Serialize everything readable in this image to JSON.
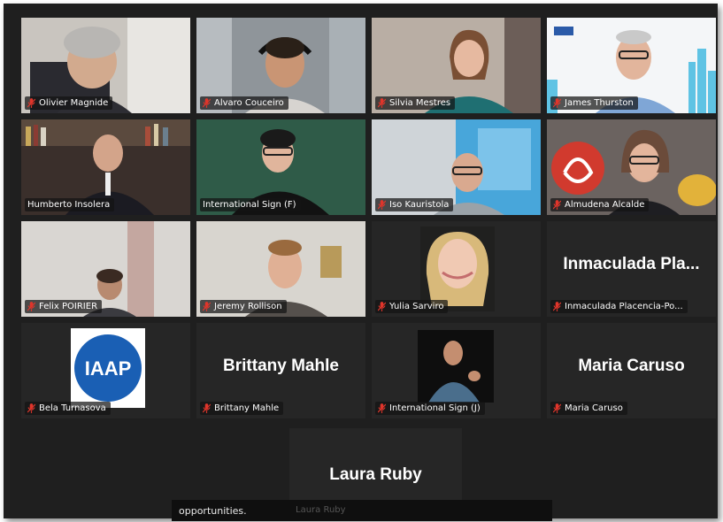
{
  "meeting": {
    "tiles": [
      {
        "name": "Olivier Magnide",
        "type": "video",
        "speaking": false
      },
      {
        "name": "Alvaro Couceiro",
        "type": "video",
        "speaking": false
      },
      {
        "name": "Silvia Mestres",
        "type": "video",
        "speaking": false
      },
      {
        "name": "James Thurston",
        "type": "video",
        "speaking": false
      },
      {
        "name": "Humberto Insolera",
        "type": "video",
        "speaking": false
      },
      {
        "name": "International Sign (F)",
        "type": "video",
        "speaking": true
      },
      {
        "name": "Iso Kauristola",
        "type": "video",
        "speaking": false
      },
      {
        "name": "Almudena Alcalde",
        "type": "video",
        "speaking": false
      },
      {
        "name": "Felix POIRIER",
        "type": "video",
        "speaking": false
      },
      {
        "name": "Jeremy Rollison",
        "type": "video",
        "speaking": false
      },
      {
        "name": "Yulia Sarviro",
        "type": "photo",
        "speaking": false
      },
      {
        "name": "Inmaculada Placencia-Po...",
        "type": "text",
        "display": "Inmaculada Pla...",
        "speaking": false
      },
      {
        "name": "Bela Turnasova",
        "type": "logo",
        "logo_text": "IAAP",
        "speaking": false
      },
      {
        "name": "Brittany Mahle",
        "type": "text",
        "display": "Brittany Mahle",
        "speaking": false
      },
      {
        "name": "International Sign (J)",
        "type": "photo",
        "speaking": false
      },
      {
        "name": "Maria Caruso",
        "type": "text",
        "display": "Maria Caruso",
        "speaking": false
      }
    ],
    "bottom_tile": {
      "display": "Laura Ruby",
      "name": "Laura Ruby"
    },
    "caption": {
      "text": "opportunities."
    },
    "colors": {
      "background": "#1f1f1f",
      "tile": "#262626",
      "speaking_border": "#d7e14a",
      "mic_muted": "#e0352b"
    },
    "icons": {
      "muted": "mic-muted-icon"
    }
  }
}
